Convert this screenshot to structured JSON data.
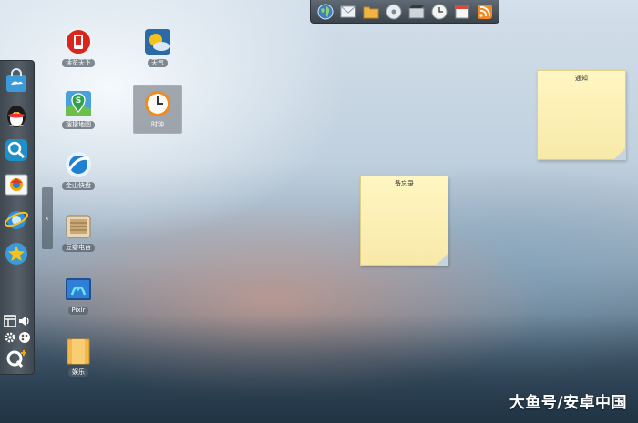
{
  "topbar": {
    "items": [
      {
        "icon": "globe-icon"
      },
      {
        "icon": "mail-icon"
      },
      {
        "icon": "folder-icon"
      },
      {
        "icon": "disc-icon"
      },
      {
        "icon": "film-icon"
      },
      {
        "icon": "clock-icon"
      },
      {
        "icon": "calendar-icon"
      },
      {
        "icon": "rss-icon"
      }
    ]
  },
  "dock": {
    "apps": [
      {
        "icon": "app-store-bag-icon"
      },
      {
        "icon": "qq-penguin-icon"
      },
      {
        "icon": "qq-search-icon"
      },
      {
        "icon": "browser-icon"
      },
      {
        "icon": "ie-browser-icon"
      },
      {
        "icon": "star-game-icon"
      }
    ],
    "tools": [
      {
        "icon": "window-switch-icon"
      },
      {
        "icon": "volume-icon"
      },
      {
        "icon": "settings-gear-icon"
      },
      {
        "icon": "theme-palette-icon"
      },
      {
        "icon": "q-plus-logo-icon"
      }
    ],
    "toggle_glyph": "‹"
  },
  "desktop_icons": [
    {
      "label": "读览天下",
      "icon": "reading-red-icon"
    },
    {
      "label": "天气",
      "icon": "weather-sun-icon"
    },
    {
      "label": "搜搜地图",
      "icon": "map-pin-icon"
    },
    {
      "label": "时钟",
      "icon": "clock-icon",
      "selected": true
    },
    {
      "label": "金山快盘",
      "icon": "kuaipan-cloud-icon"
    },
    {
      "label": "豆瓣电台",
      "icon": "radio-icon"
    },
    {
      "label": "Pixlr",
      "icon": "pixlr-icon"
    },
    {
      "label": "娱乐",
      "icon": "folder-icon"
    }
  ],
  "notes": [
    {
      "title": "通知"
    },
    {
      "title": "备忘录"
    }
  ],
  "watermark": "大鱼号/安卓中国",
  "colors": {
    "note_yellow": "#fff6c2",
    "dock_gray": "#4a535b",
    "label_bg": "#555f69"
  }
}
